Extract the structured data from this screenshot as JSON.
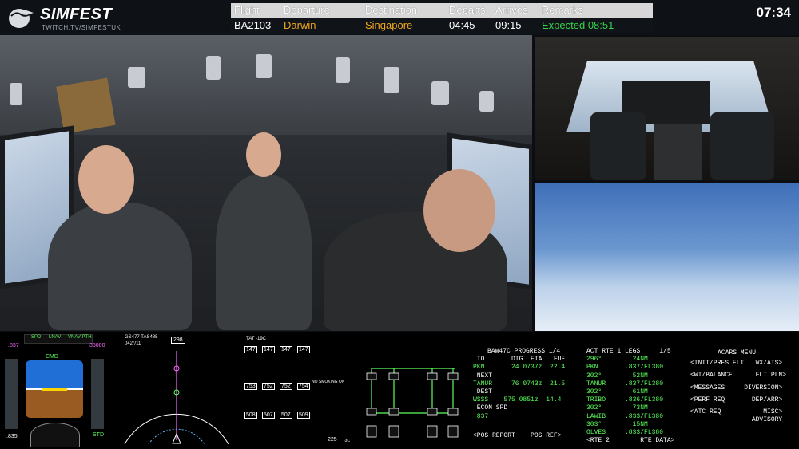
{
  "brand": {
    "name": "SIMFEST",
    "subtitle": "TWITCH.TV/SIMFESTUK"
  },
  "clock": "07:34",
  "board": {
    "headers": [
      "Flight",
      "Departure",
      "Destination",
      "Departs",
      "Arrives",
      "Remarks"
    ],
    "row": {
      "flight": "BA2103",
      "departure": "Darwin",
      "destination": "Singapore",
      "departs": "04:45",
      "arrives": "09:15",
      "remarks": "Expected 08:51"
    },
    "colors": {
      "departure": "#f0a81a",
      "destination": "#f0a81a",
      "remarks": "#35d44a"
    }
  },
  "progress": {
    "title": "BAW47C PROGRESS 1/4",
    "line1": " TO       DTG  ETA   FUEL",
    "line2": "PKN       24 0737z  22.4",
    " line3": "",
    "next_label": " NEXT",
    "line4": "TANUR     76 0743z  21.5",
    "dest_label": " DEST",
    "line5": "WSSS    575 0851z  14.4",
    "spd_label": " ECON SPD",
    "line6": ".837",
    "footer": "<POS REPORT    POS REF>"
  },
  "rte": {
    "title": "ACT RTE 1 LEGS     1/5",
    "lines": [
      "296°        24NM",
      "PKN       .837/FL380",
      "302°        52NM",
      "TANUR     .837/FL380",
      "302°        61NM",
      "TRIBO     .836/FL380",
      "302°        73NM",
      "LAWIB     .833/FL380",
      "303°        15NM",
      "OLVES     .833/FL380"
    ],
    "footer": "<RTE 2        RTE DATA>"
  },
  "acars": {
    "title": "ACARS MENU",
    "lines": [
      "<INIT/PRES FLT   WX/AIS>",
      "<WT/BALANCE      FLT PLN>",
      "<MESSAGES     DIVERSION>",
      "<PERF REQ       DEP/ARR>",
      "<ATC REQ           MISC>",
      "                ADVISORY"
    ]
  },
  "pfd": {
    "speed": ".837",
    "mach": ".835",
    "alt": "38000",
    "std": "STD",
    "mode": [
      "SPD",
      "LNAV",
      "VNAV PTH"
    ],
    "cmd": "CMD"
  },
  "nd": {
    "hdg": "298",
    "gs": "GS477 TAS485",
    "wind": "042°/11"
  },
  "eicas": {
    "tat": "TAT -19C",
    "n1": [
      "147",
      "147",
      "147",
      "147"
    ],
    "egt": [
      "753",
      "752",
      "752",
      "754"
    ],
    "ff": [
      "508",
      "507",
      "507",
      "509"
    ],
    "msg": "NO SMOKING ON",
    "total_fuel": "225",
    "temp": "-3C"
  }
}
